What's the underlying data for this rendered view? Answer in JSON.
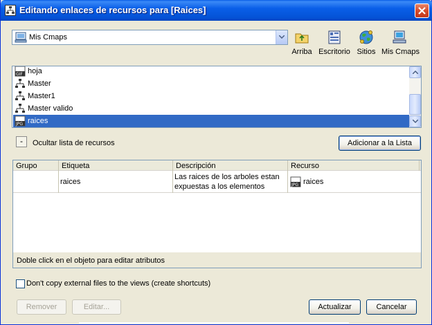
{
  "window": {
    "title": "Editando enlaces de recursos para [Raices]"
  },
  "location": {
    "selected": "Mis Cmaps",
    "icon": "my-cmaps-icon"
  },
  "toolbar": {
    "up_label": "Arriba",
    "desktop_label": "Escritorio",
    "sites_label": "Sitios",
    "mycmaps_label": "Mis Cmaps"
  },
  "resources": [
    {
      "label": "hoja",
      "icon": "gif-file-icon"
    },
    {
      "label": "Master",
      "icon": "cmap-icon"
    },
    {
      "label": "Master1",
      "icon": "cmap-icon"
    },
    {
      "label": "Master valido",
      "icon": "cmap-icon"
    },
    {
      "label": "raices",
      "icon": "jpg-file-icon",
      "selected": true
    }
  ],
  "hide_list": {
    "toggle": "-",
    "label": "Ocultar lista de recursos"
  },
  "add_button": "Adicionar a la Lista",
  "table": {
    "headers": [
      "Grupo",
      "Etiqueta",
      "Descripción",
      "Recurso"
    ],
    "row": {
      "grupo": "",
      "etiqueta": "raices",
      "descripcion_1": "Las raices de los arboles estan",
      "descripcion_2": "expuestas a los elementos",
      "recurso": "raices"
    },
    "status": "Doble click en el objeto para editar atributos"
  },
  "dont_copy": {
    "label": "Don't copy external files to the views (create shortcuts)",
    "checked": false
  },
  "buttons": {
    "remove": "Remover",
    "edit": "Editar...",
    "update": "Actualizar",
    "cancel": "Cancelar"
  },
  "colors": {
    "titlebar": "#0A5FE8",
    "selection": "#316AC5",
    "background": "#ECE9D8"
  }
}
